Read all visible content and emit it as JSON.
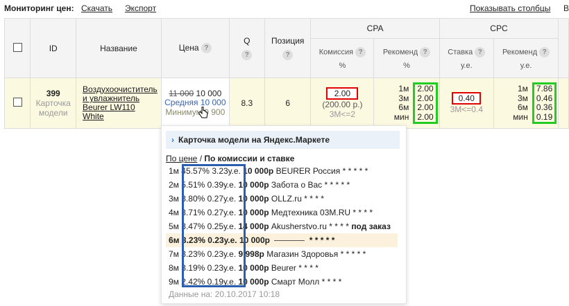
{
  "topbar": {
    "monitoring_label": "Мониторинг цен:",
    "download_link": "Скачать",
    "export_link": "Экспорт",
    "show_columns_link": "Показывать столбцы",
    "clipped_link": "В"
  },
  "table": {
    "headers": {
      "id": "ID",
      "name": "Название",
      "price": "Цена",
      "q": "Q",
      "position": "Позиция",
      "cpa": "CPA",
      "cpc": "CPC",
      "commission": "Комиссия",
      "commission_unit": "%",
      "recommend_cpa": "Рекоменд",
      "recommend_cpa_unit": "%",
      "bid": "Ставка",
      "bid_unit": "у.е.",
      "recommend_cpc": "Рекоменд",
      "recommend_cpc_unit": "у.е."
    },
    "help_glyph": "?",
    "row": {
      "id": "399",
      "id_sub_1": "Карточка",
      "id_sub_2": "модели",
      "name_lines": [
        "Воздухоочиститель",
        "и увлажнитель",
        "Beurer LW110",
        "White"
      ],
      "price_old": "11 000",
      "price_current": "10 000",
      "price_avg": "Средняя 10 000",
      "price_min": "Минимум 9 900",
      "q": "8.3",
      "position": "6",
      "commission": "2.00",
      "commission_sub_1": "(200.00 р.)",
      "commission_sub_2": "3М<=2",
      "rec_cpa_periods": [
        "1м",
        "3м",
        "6м",
        "мин"
      ],
      "rec_cpa_values": [
        "2.00",
        "2.00",
        "2.00",
        "2.00"
      ],
      "bid": "0.40",
      "bid_sub": "3М<=0.4",
      "rec_cpc_periods": [
        "1м",
        "3м",
        "6м",
        "мин"
      ],
      "rec_cpc_values": [
        "7.86",
        "0.46",
        "0.36",
        "0.19"
      ]
    }
  },
  "popup": {
    "title": "Карточка модели на Яндекс.Маркете",
    "tab_price": "По цене",
    "tab_sep": " / ",
    "tab_commission": "По комиссии и ставке",
    "offers": [
      {
        "period": "1м",
        "pct": "45.57%",
        "ue": "3.23у.е.",
        "price": "10 000р",
        "shop": "BEURER Россия",
        "stars": "* * * * *",
        "extra": ""
      },
      {
        "period": "2м",
        "pct": "5.51%",
        "ue": "0.39у.е.",
        "price": "10 000р",
        "shop": "Забота о Вас",
        "stars": "* * * * *",
        "extra": ""
      },
      {
        "period": "3м",
        "pct": "3.80%",
        "ue": "0.27у.е.",
        "price": "10 000р",
        "shop": "OLLZ.ru",
        "stars": "* * * *",
        "extra": ""
      },
      {
        "period": "4м",
        "pct": "3.71%",
        "ue": "0.27у.е.",
        "price": "10 000р",
        "shop": "Медтехника 03M.RU",
        "stars": "* * * *",
        "extra": ""
      },
      {
        "period": "5м",
        "pct": "3.47%",
        "ue": "0.25у.е.",
        "price": "14 000р",
        "shop": "Akusherstvo.ru",
        "stars": "* * * *",
        "extra": "под заказ"
      },
      {
        "period": "6м",
        "pct": "3.23%",
        "ue": "0.23у.е.",
        "price": "10 000р",
        "shop": "",
        "stars": "* * * * *",
        "extra": ""
      },
      {
        "period": "7м",
        "pct": "3.23%",
        "ue": "0.23у.е.",
        "price": "9 998р",
        "shop": "Магазин Здоровья",
        "stars": "* * * * *",
        "extra": ""
      },
      {
        "period": "8м",
        "pct": "3.19%",
        "ue": "0.23у.е.",
        "price": "10 000р",
        "shop": "Beurer",
        "stars": "* * * *",
        "extra": ""
      },
      {
        "period": "9м",
        "pct": "2.42%",
        "ue": "0.19у.е.",
        "price": "10 000р",
        "shop": "Смарт Молл",
        "stars": "* * * *",
        "extra": ""
      }
    ],
    "footer": "Данные на: 20.10.2017 10:18"
  },
  "colors": {
    "row_bg": "#fcf9e1",
    "header_bg": "#f4f4f4",
    "red_box": "#e00000",
    "green_box": "#22cc22",
    "blue_box": "#2a5fb0",
    "link_blue": "#3a64b0"
  }
}
